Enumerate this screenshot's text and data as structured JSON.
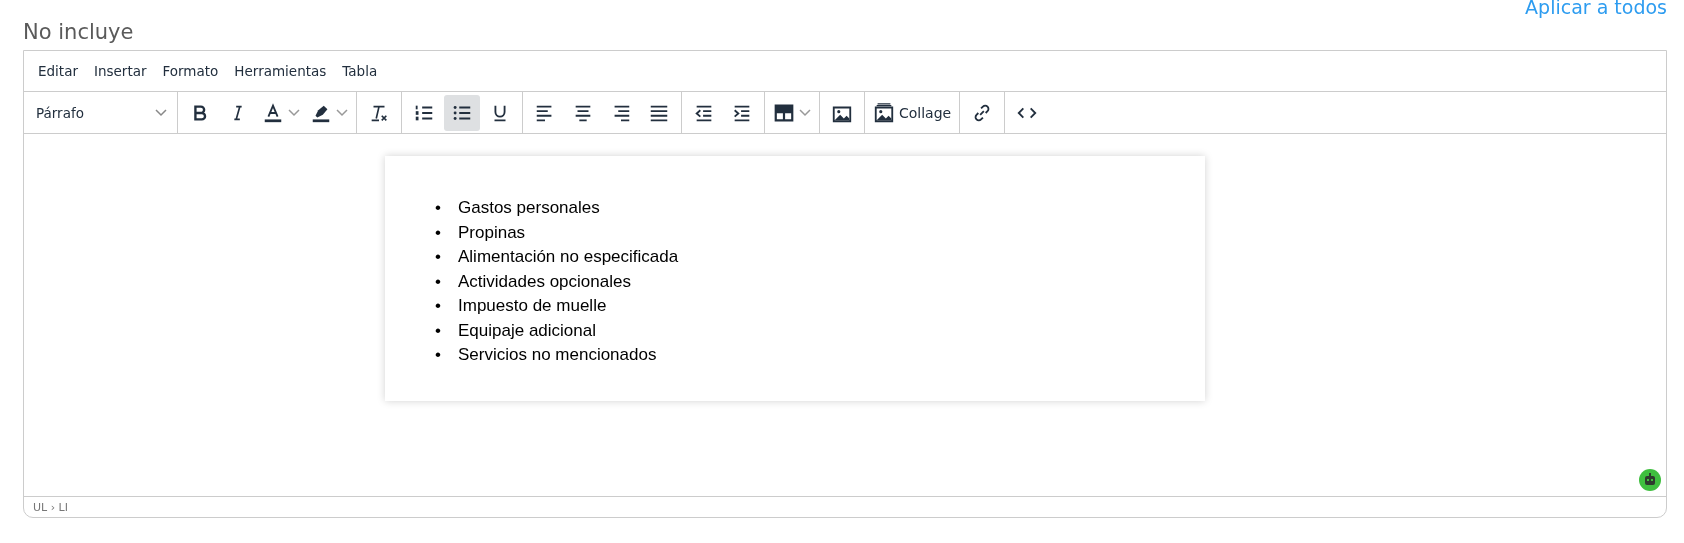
{
  "apply_link": "Aplicar a todos",
  "section_title": "No incluye",
  "menubar": [
    "Editar",
    "Insertar",
    "Formato",
    "Herramientas",
    "Tabla"
  ],
  "block_format": {
    "value": "Párrafo"
  },
  "toolbar_groups": [
    [
      {
        "kind": "bold",
        "selected": false
      },
      {
        "kind": "italic",
        "selected": false
      },
      {
        "kind": "text-color",
        "selected": false
      },
      {
        "kind": "highlight",
        "selected": false
      }
    ],
    [
      {
        "kind": "clear-format",
        "selected": false
      }
    ],
    [
      {
        "kind": "numbered-list",
        "selected": false
      },
      {
        "kind": "bullet-list",
        "selected": true
      },
      {
        "kind": "underline",
        "selected": false
      }
    ],
    [
      {
        "kind": "align-left",
        "selected": false
      },
      {
        "kind": "align-center",
        "selected": false
      },
      {
        "kind": "align-right",
        "selected": false
      },
      {
        "kind": "justify",
        "selected": false
      }
    ],
    [
      {
        "kind": "outdent",
        "selected": false
      },
      {
        "kind": "indent",
        "selected": false
      }
    ],
    [
      {
        "kind": "table",
        "selected": false
      }
    ],
    [
      {
        "kind": "image",
        "selected": false
      }
    ],
    [
      {
        "kind": "collage",
        "label": "Collage",
        "selected": false
      }
    ],
    [
      {
        "kind": "link",
        "selected": false
      }
    ],
    [
      {
        "kind": "code",
        "selected": false
      }
    ]
  ],
  "document": {
    "bullet": "•",
    "items": [
      "Gastos personales",
      "Propinas",
      "Alimentación no especificada",
      "Actividades opcionales",
      "Impuesto de muelle",
      "Equipaje adicional",
      "Servicios no mencionados"
    ]
  },
  "status_path": "UL › LI"
}
